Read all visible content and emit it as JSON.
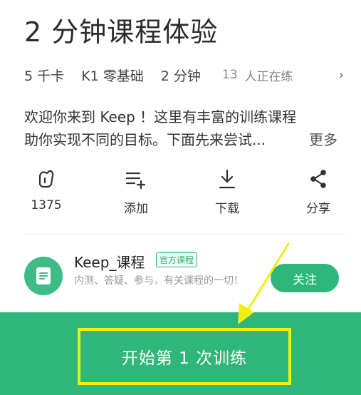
{
  "course": {
    "title": "2 分钟课程体验"
  },
  "meta": {
    "calories": "5 千卡",
    "level": "K1 零基础",
    "duration": "2 分钟",
    "count": "13",
    "viewers": "人正在练",
    "chevron": "›"
  },
  "description": {
    "line1": "欢迎你来到 Keep ！这里有丰富的训练课程",
    "line2": "助你实现不同的目标。下面先来尝试...",
    "more": "更多"
  },
  "actions": [
    {
      "icon": "like-icon",
      "label": "1375"
    },
    {
      "icon": "add-playlist-icon",
      "label": "添加"
    },
    {
      "icon": "download-icon",
      "label": "下载"
    },
    {
      "icon": "share-icon",
      "label": "分享"
    }
  ],
  "author": {
    "name": "Keep_课程",
    "badge": "官方课程",
    "intro": "内测、答疑、参与，有关课程的一切！",
    "follow": "关注"
  },
  "cta": {
    "label": "开始第 1 次训练"
  },
  "colors": {
    "accent": "#2fb67a",
    "highlight": "#f3ee12"
  }
}
